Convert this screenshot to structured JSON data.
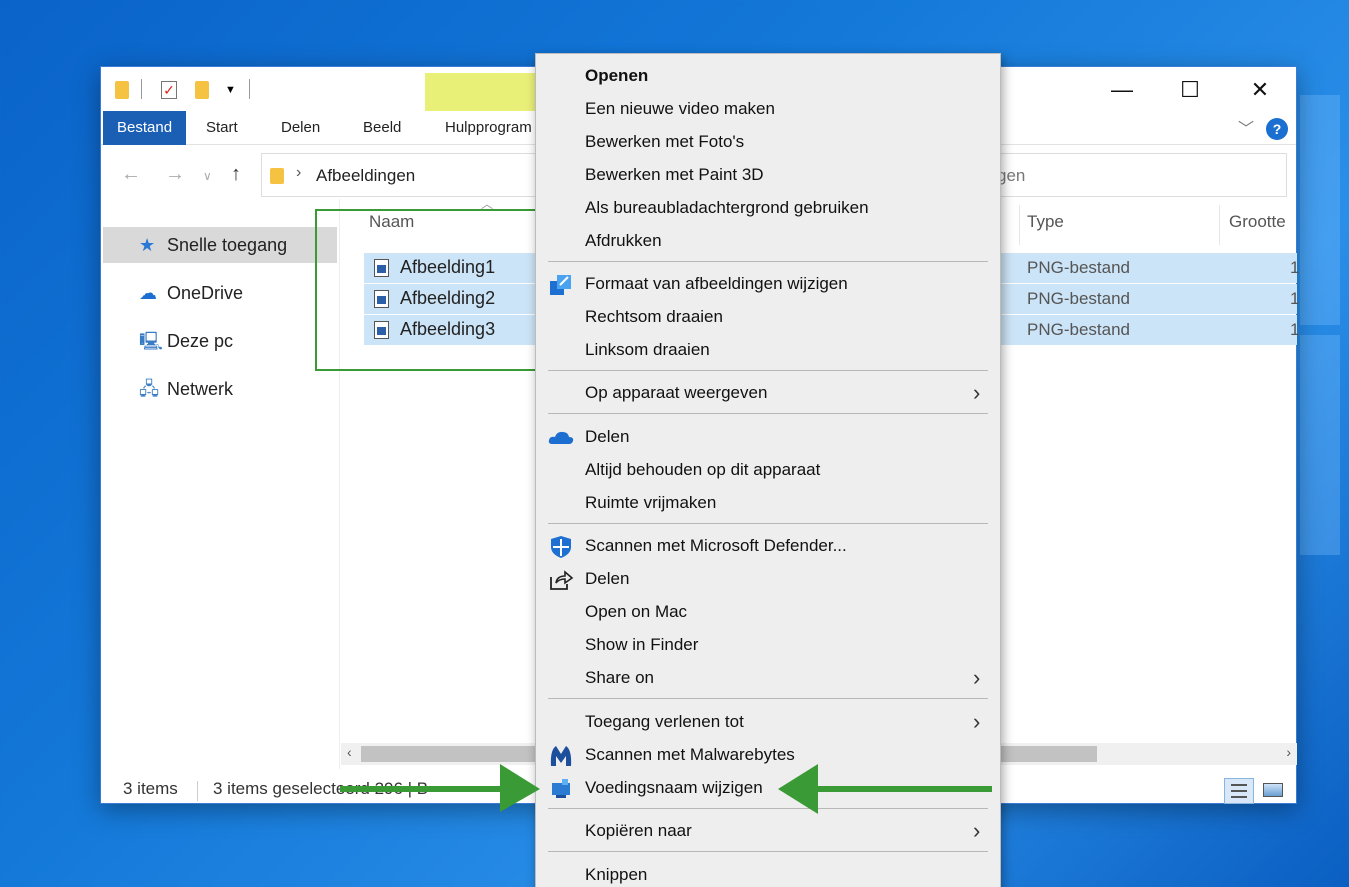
{
  "window": {
    "ribbon_tabs": [
      "Bestand",
      "Start",
      "Delen",
      "Beeld",
      "Hulpprogram"
    ],
    "address_path": "Afbeeldingen",
    "search_fragment": "gen"
  },
  "sidebar": {
    "items": [
      {
        "label": "Snelle toegang",
        "icon": "star-icon"
      },
      {
        "label": "OneDrive",
        "icon": "cloud-icon"
      },
      {
        "label": "Deze pc",
        "icon": "computer-icon"
      },
      {
        "label": "Netwerk",
        "icon": "network-icon"
      }
    ]
  },
  "columns": {
    "name": "Naam",
    "type": "Type",
    "size": "Grootte"
  },
  "files": [
    {
      "name": "Afbeelding1",
      "type": "PNG-bestand",
      "size": "1"
    },
    {
      "name": "Afbeelding2",
      "type": "PNG-bestand",
      "size": "1"
    },
    {
      "name": "Afbeelding3",
      "type": "PNG-bestand",
      "size": "1"
    }
  ],
  "status": {
    "count": "3 items",
    "selected": "3 items geselecteerd  296 | B"
  },
  "context_menu": {
    "items": [
      {
        "label": "Openen"
      },
      {
        "label": "Een nieuwe video maken"
      },
      {
        "label": "Bewerken met Foto's"
      },
      {
        "label": "Bewerken met Paint 3D"
      },
      {
        "label": "Als bureaubladachtergrond gebruiken"
      },
      {
        "label": "Afdrukken"
      },
      {
        "label": "Formaat van afbeeldingen wijzigen"
      },
      {
        "label": "Rechtsom draaien"
      },
      {
        "label": "Linksom draaien"
      },
      {
        "label": "Op apparaat weergeven"
      },
      {
        "label": "Delen"
      },
      {
        "label": "Altijd behouden op dit apparaat"
      },
      {
        "label": "Ruimte vrijmaken"
      },
      {
        "label": "Scannen met Microsoft Defender..."
      },
      {
        "label": "Delen"
      },
      {
        "label": "Open on Mac"
      },
      {
        "label": "Show in Finder"
      },
      {
        "label": "Share on"
      },
      {
        "label": "Toegang verlenen tot"
      },
      {
        "label": "Scannen met Malwarebytes"
      },
      {
        "label": "Voedingsnaam wijzigen"
      },
      {
        "label": "Kopiëren naar"
      },
      {
        "label": "Knippen"
      }
    ]
  },
  "colors": {
    "accent": "#1a5fb4",
    "selection": "#cce4f7",
    "highlight_arrow": "#3a9a35"
  }
}
